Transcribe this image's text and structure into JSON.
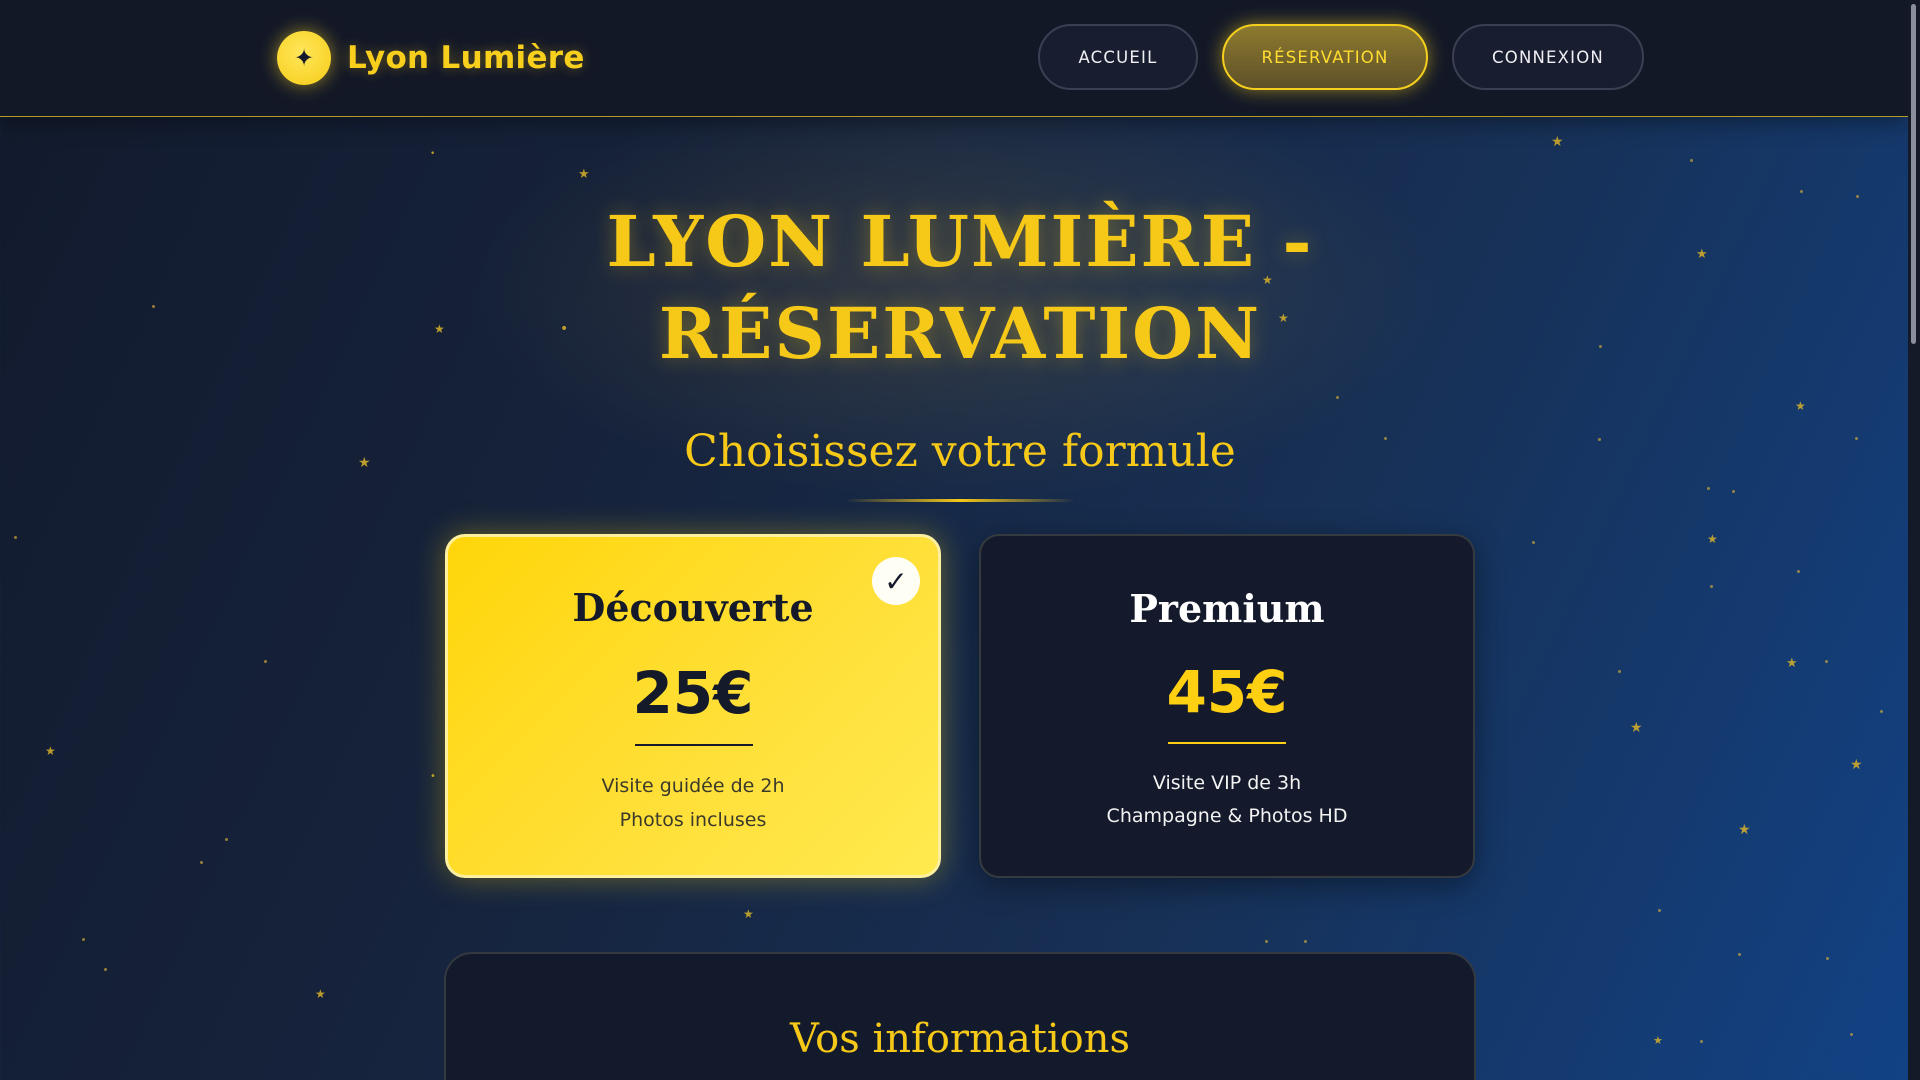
{
  "brand": {
    "logo_symbol": "✦",
    "logo_icon": "sparkle-icon",
    "name": "Lyon Lumière"
  },
  "nav": {
    "items": [
      {
        "label": "ACCUEIL",
        "active": false
      },
      {
        "label": "RÉSERVATION",
        "active": true
      },
      {
        "label": "CONNEXION",
        "active": false
      }
    ]
  },
  "page": {
    "title_line1": "LYON LUMIÈRE -",
    "title_line2": "RÉSERVATION",
    "subtitle": "Choisissez votre formule"
  },
  "plans": [
    {
      "name": "Découverte",
      "price": "25€",
      "line1": "Visite guidée de 2h",
      "line2": "Photos incluses",
      "selected": true,
      "check_symbol": "✓"
    },
    {
      "name": "Premium",
      "price": "45€",
      "line1": "Visite VIP de 3h",
      "line2": "Champagne & Photos HD",
      "selected": false
    }
  ],
  "info_section": {
    "title": "Vos informations"
  },
  "colors": {
    "accent": "#f6c818",
    "header_bg": "#131827",
    "card_dark": "#141a2b",
    "card_selected": "#ffd60a"
  }
}
